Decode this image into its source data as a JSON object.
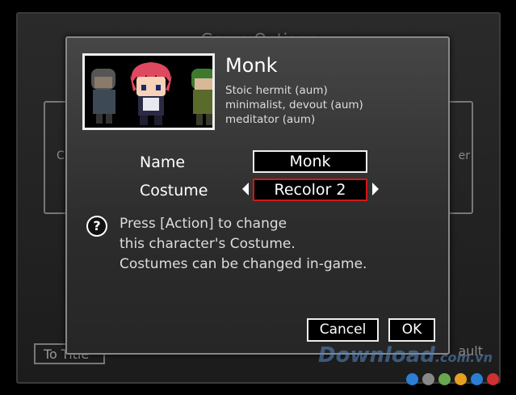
{
  "background": {
    "title": "Game Options",
    "left_panel_text": "C",
    "right_panel_text": "er",
    "title_button_label": "To Title",
    "right_button_label": "ault"
  },
  "dialog": {
    "character_name": "Monk",
    "traits": [
      "Stoic hermit (aum)",
      "minimalist, devout (aum)",
      "meditator (aum)"
    ],
    "name_label": "Name",
    "name_value": "Monk",
    "costume_label": "Costume",
    "costume_value": "Recolor 2",
    "help_icon_glyph": "?",
    "help_lines": [
      "Press [Action] to change",
      "this character's Costume.",
      "Costumes can be changed in-game."
    ],
    "cancel_label": "Cancel",
    "ok_label": "OK"
  },
  "watermark": {
    "brand": "Download",
    "domain": ".com.vn",
    "dot_colors": [
      "#2a7fd4",
      "#888888",
      "#6aa84f",
      "#e6a020",
      "#2a7fd4",
      "#d03030"
    ]
  },
  "colors": {
    "selected_border": "#d01818",
    "box_border": "#eeeeee",
    "dialog_border": "#888888"
  },
  "icons": {
    "help": "help-circle-icon",
    "left": "arrow-left-icon",
    "right": "arrow-right-icon"
  }
}
